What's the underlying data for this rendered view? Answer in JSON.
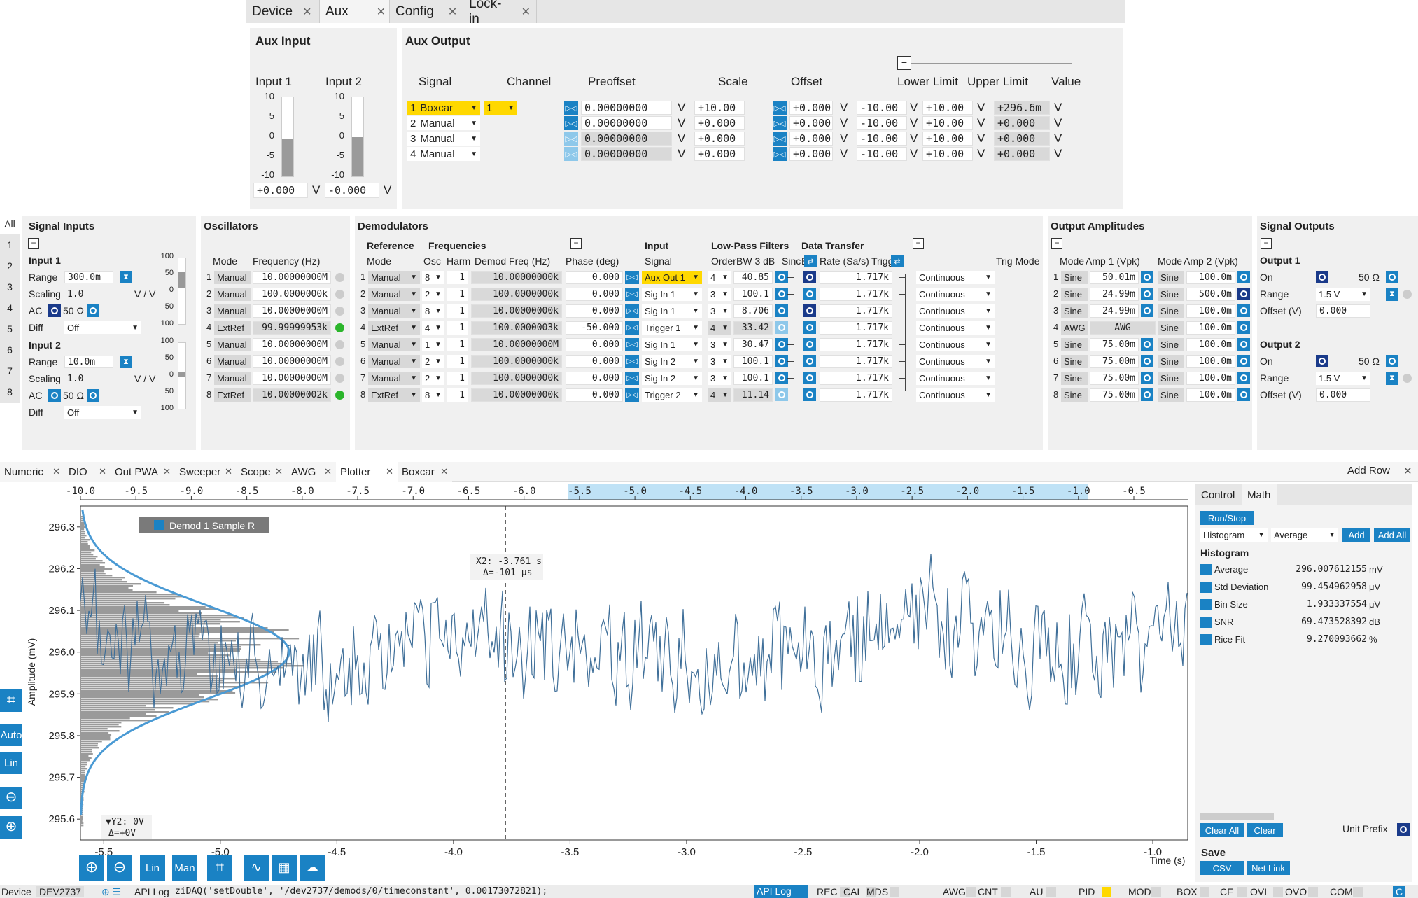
{
  "top_tabs": [
    {
      "label": "Device",
      "close": "✕"
    },
    {
      "label": "Aux",
      "close": "✕"
    },
    {
      "label": "Config",
      "close": "✕"
    },
    {
      "label": "Lock-in",
      "close": "✕"
    }
  ],
  "aux_input": {
    "title": "Aux Input",
    "input1_label": "Input 1",
    "input2_label": "Input 2",
    "meter_ticks": [
      "10",
      "5",
      "0",
      "-5",
      "-10"
    ],
    "input1_value": "+0.000",
    "input2_value": "-0.000",
    "unit": "V",
    "input1_level": 0.47,
    "input2_level": 0.5
  },
  "aux_output": {
    "title": "Aux Output",
    "headers": {
      "signal": "Signal",
      "channel": "Channel",
      "preoffset": "Preoffset",
      "scale": "Scale",
      "offset": "Offset",
      "lower": "Lower Limit",
      "upper": "Upper Limit",
      "value": "Value"
    },
    "unit": "V",
    "rows": [
      {
        "n": "1",
        "signal": "Boxcar",
        "channel": "1",
        "preoffset": "0.00000000",
        "scale": "+10.00",
        "offset": "+0.000",
        "lower": "-10.00",
        "upper": "+10.00",
        "value": "+296.6m"
      },
      {
        "n": "2",
        "signal": "Manual",
        "channel": "",
        "preoffset": "0.00000000",
        "scale": "+0.000",
        "offset": "+0.000",
        "lower": "-10.00",
        "upper": "+10.00",
        "value": "+0.000"
      },
      {
        "n": "3",
        "signal": "Manual",
        "channel": "",
        "preoffset": "0.00000000",
        "scale": "+0.000",
        "offset": "+0.000",
        "lower": "-10.00",
        "upper": "+10.00",
        "value": "+0.000"
      },
      {
        "n": "4",
        "signal": "Manual",
        "channel": "",
        "preoffset": "0.00000000",
        "scale": "+0.000",
        "offset": "+0.000",
        "lower": "-10.00",
        "upper": "+10.00",
        "value": "+0.000"
      }
    ]
  },
  "side_tabs": [
    "All",
    "1",
    "2",
    "3",
    "4",
    "5",
    "6",
    "7",
    "8"
  ],
  "signal_inputs": {
    "title": "Signal Inputs",
    "input1": {
      "label": "Input 1",
      "range_label": "Range",
      "range": "300.0m",
      "scaling_label": "Scaling",
      "scaling": "1.0",
      "scaling_unit": "V / V",
      "ac": "AC",
      "imp": "50 Ω",
      "diff_label": "Diff",
      "diff": "Off"
    },
    "input2": {
      "label": "Input 2",
      "range_label": "Range",
      "range": "10.0m",
      "scaling_label": "Scaling",
      "scaling": "1.0",
      "scaling_unit": "V / V",
      "ac": "AC",
      "imp": "50 Ω",
      "diff_label": "Diff",
      "diff": "Off"
    },
    "meter_ticks": [
      "100",
      "50",
      "0",
      "50",
      "100"
    ]
  },
  "oscillators": {
    "title": "Oscillators",
    "mode_header": "Mode",
    "freq_header": "Frequency (Hz)",
    "rows": [
      [
        "1",
        "Manual",
        "10.00000000M"
      ],
      [
        "2",
        "Manual",
        "100.0000000k"
      ],
      [
        "3",
        "Manual",
        "10.00000000M"
      ],
      [
        "4",
        "ExtRef",
        "99.99999953k"
      ],
      [
        "5",
        "Manual",
        "10.00000000M"
      ],
      [
        "6",
        "Manual",
        "10.00000000M"
      ],
      [
        "7",
        "Manual",
        "10.00000000M"
      ],
      [
        "8",
        "ExtRef",
        "10.00000002k"
      ]
    ]
  },
  "demodulators": {
    "title": "Demodulators",
    "h_reference": "Reference",
    "h_frequencies": "Frequencies",
    "h_input": "Input",
    "h_lpf": "Low-Pass Filters",
    "h_dt": "Data Transfer",
    "h_mode": "Mode",
    "h_osc": "Osc",
    "h_harm": "Harm",
    "h_dfreq": "Demod Freq (Hz)",
    "h_phase": "Phase (deg)",
    "h_signal": "Signal",
    "h_order": "Order",
    "h_bw": "BW 3 dB",
    "h_sinc": "Sinc",
    "h_en": "En",
    "h_rate": "Rate (Sa/s)",
    "h_trigger": "Trigger",
    "h_trigmode": "Trig Mode",
    "rows": [
      [
        "1",
        "Manual",
        "8",
        "1",
        "10.00000000k",
        "0.000",
        "Aux Out 1",
        "4",
        "40.85",
        "1.717k",
        "Continuous"
      ],
      [
        "2",
        "Manual",
        "2",
        "1",
        "100.0000000k",
        "0.000",
        "Sig In 1",
        "3",
        "100.1",
        "1.717k",
        "Continuous"
      ],
      [
        "3",
        "Manual",
        "8",
        "1",
        "10.00000000k",
        "0.000",
        "Sig In 1",
        "3",
        "8.706",
        "1.717k",
        "Continuous"
      ],
      [
        "4",
        "ExtRef",
        "4",
        "1",
        "100.0000003k",
        "-50.000",
        "Trigger 1",
        "4",
        "33.42",
        "1.717k",
        "Continuous"
      ],
      [
        "5",
        "Manual",
        "1",
        "1",
        "10.00000000M",
        "0.000",
        "Sig In 1",
        "3",
        "30.47",
        "1.717k",
        "Continuous"
      ],
      [
        "6",
        "Manual",
        "2",
        "1",
        "100.0000000k",
        "0.000",
        "Sig In 2",
        "3",
        "100.1",
        "1.717k",
        "Continuous"
      ],
      [
        "7",
        "Manual",
        "2",
        "1",
        "100.0000000k",
        "0.000",
        "Sig In 2",
        "3",
        "100.1",
        "1.717k",
        "Continuous"
      ],
      [
        "8",
        "ExtRef",
        "8",
        "1",
        "10.00000000k",
        "0.000",
        "Trigger 2",
        "4",
        "11.14",
        "1.717k",
        "Continuous"
      ]
    ]
  },
  "output_amplitudes": {
    "title": "Output Amplitudes",
    "h_mode": "Mode",
    "h_amp1": "Amp 1 (Vpk)",
    "h_mode2": "Mode",
    "h_amp2": "Amp 2 (Vpk)",
    "rows": [
      [
        "1",
        "Sine",
        "50.01m",
        "Sine",
        "100.0m"
      ],
      [
        "2",
        "Sine",
        "24.99m",
        "Sine",
        "500.0m"
      ],
      [
        "3",
        "Sine",
        "24.99m",
        "Sine",
        "100.0m"
      ],
      [
        "4",
        "AWG",
        "AWG",
        "Sine",
        "100.0m"
      ],
      [
        "5",
        "Sine",
        "75.00m",
        "Sine",
        "100.0m"
      ],
      [
        "6",
        "Sine",
        "75.00m",
        "Sine",
        "100.0m"
      ],
      [
        "7",
        "Sine",
        "75.00m",
        "Sine",
        "100.0m"
      ],
      [
        "8",
        "Sine",
        "75.00m",
        "Sine",
        "100.0m"
      ]
    ]
  },
  "signal_outputs": {
    "title": "Signal Outputs",
    "output1": {
      "label": "Output 1",
      "on": "On",
      "imp": "50 Ω",
      "range_label": "Range",
      "range": "1.5 V",
      "offset_label": "Offset (V)",
      "offset": "0.000"
    },
    "output2": {
      "label": "Output 2",
      "on": "On",
      "imp": "50 Ω",
      "range_label": "Range",
      "range": "1.5 V",
      "offset_label": "Offset (V)",
      "offset": "0.000"
    }
  },
  "bottom_tabs": [
    {
      "label": "Numeric",
      "close": "✕"
    },
    {
      "label": "DIO",
      "close": "✕"
    },
    {
      "label": "Out PWA",
      "close": "✕"
    },
    {
      "label": "Sweeper",
      "close": "✕"
    },
    {
      "label": "Scope",
      "close": "✕"
    },
    {
      "label": "AWG",
      "close": "✕"
    },
    {
      "label": "Plotter",
      "close": "✕"
    },
    {
      "label": "Boxcar",
      "close": "✕"
    }
  ],
  "add_row": "Add Row",
  "add_row_close": "✕",
  "plot": {
    "ylabel": "Amplitude (mV)",
    "xlabel": "Time (s)",
    "legend": "Demod 1 Sample R",
    "cursor_x": "X2: -3.761 s",
    "cursor_dx": "Δ=-101 μs",
    "cursor_y": "▼Y2: 0V",
    "cursor_dy": "Δ=+0V",
    "y_ticks": [
      "296.3",
      "296.2",
      "296.1",
      "296.0",
      "295.9",
      "295.8",
      "295.7",
      "295.6"
    ],
    "x_ticks": [
      "-5.5",
      "-5.0",
      "-4.5",
      "-4.0",
      "-3.5",
      "-3.0",
      "-2.5",
      "-2.0",
      "-1.5",
      "-1.0"
    ],
    "top_ticks": [
      "-10.0",
      "-9.5",
      "-9.0",
      "-8.5",
      "-8.0",
      "-7.5",
      "-7.0",
      "-6.5",
      "-6.0",
      "-5.5",
      "-5.0",
      "-4.5",
      "-4.0",
      "-3.5",
      "-3.0",
      "-2.5",
      "-2.0",
      "-1.5",
      "-1.0",
      "-0.5"
    ],
    "side_buttons": [
      "Auto",
      "Lin"
    ],
    "bottom_buttons": [
      "Lin",
      "Man"
    ]
  },
  "chart_data": {
    "type": "line",
    "title": "",
    "xlabel": "Time (s)",
    "ylabel": "Amplitude (mV)",
    "xlim": [
      -5.6,
      -0.85
    ],
    "ylim": [
      295.55,
      296.35
    ],
    "series": [
      {
        "name": "Demod 1 Sample R",
        "mean": 296.0076,
        "std_uv": 99.45
      }
    ],
    "histogram_fit": "Rice Fit"
  },
  "math_panel": {
    "tabs": [
      "Control",
      "Math"
    ],
    "run_stop": "Run/Stop",
    "op1": "Histogram",
    "op2": "Average",
    "add": "Add",
    "add_all": "Add All",
    "section": "Histogram",
    "rows": [
      [
        "Average",
        "296.007612155",
        "mV"
      ],
      [
        "Std Deviation",
        "99.454962958",
        "μV"
      ],
      [
        "Bin Size",
        "1.933337554",
        "μV"
      ],
      [
        "SNR",
        "69.473528392",
        "dB"
      ],
      [
        "Rice Fit",
        "9.270093662",
        "%"
      ]
    ],
    "clear_all": "Clear All",
    "clear": "Clear",
    "unit_prefix": "Unit Prefix",
    "save": "Save",
    "csv": "CSV",
    "net_link": "Net Link"
  },
  "status": {
    "device_label": "Device",
    "device": "DEV2737",
    "api_log": "API Log",
    "command": "ziDAQ('setDouble', '/dev2737/demods/0/timeconstant', 0.00173072821);",
    "api_log_btn": "API Log",
    "items": [
      "REC",
      "CAL",
      "MDS",
      "AWG",
      "CNT",
      "AU",
      "PID",
      "MOD",
      "BOX",
      "CF",
      "OVI",
      "OVO",
      "COM",
      "C"
    ]
  }
}
